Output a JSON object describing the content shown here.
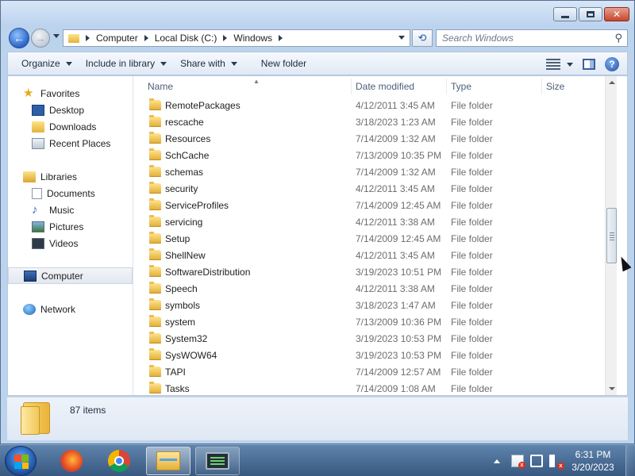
{
  "address": {
    "crumbs": [
      "Computer",
      "Local Disk (C:)",
      "Windows"
    ]
  },
  "search": {
    "placeholder": "Search Windows"
  },
  "toolbar": {
    "organize": "Organize",
    "include_in_library": "Include in library",
    "share_with": "Share with",
    "new_folder": "New folder"
  },
  "navpane": {
    "favorites": "Favorites",
    "desktop": "Desktop",
    "downloads": "Downloads",
    "recent_places": "Recent Places",
    "libraries": "Libraries",
    "documents": "Documents",
    "music": "Music",
    "pictures": "Pictures",
    "videos": "Videos",
    "computer": "Computer",
    "network": "Network"
  },
  "columns": {
    "name": "Name",
    "date_modified": "Date modified",
    "type": "Type",
    "size": "Size"
  },
  "rows": [
    {
      "name": "RemotePackages",
      "date": "4/12/2011 3:45 AM",
      "type": "File folder"
    },
    {
      "name": "rescache",
      "date": "3/18/2023 1:23 AM",
      "type": "File folder"
    },
    {
      "name": "Resources",
      "date": "7/14/2009 1:32 AM",
      "type": "File folder"
    },
    {
      "name": "SchCache",
      "date": "7/13/2009 10:35 PM",
      "type": "File folder"
    },
    {
      "name": "schemas",
      "date": "7/14/2009 1:32 AM",
      "type": "File folder"
    },
    {
      "name": "security",
      "date": "4/12/2011 3:45 AM",
      "type": "File folder"
    },
    {
      "name": "ServiceProfiles",
      "date": "7/14/2009 12:45 AM",
      "type": "File folder"
    },
    {
      "name": "servicing",
      "date": "4/12/2011 3:38 AM",
      "type": "File folder"
    },
    {
      "name": "Setup",
      "date": "7/14/2009 12:45 AM",
      "type": "File folder"
    },
    {
      "name": "ShellNew",
      "date": "4/12/2011 3:45 AM",
      "type": "File folder"
    },
    {
      "name": "SoftwareDistribution",
      "date": "3/19/2023 10:51 PM",
      "type": "File folder"
    },
    {
      "name": "Speech",
      "date": "4/12/2011 3:38 AM",
      "type": "File folder"
    },
    {
      "name": "symbols",
      "date": "3/18/2023 1:47 AM",
      "type": "File folder"
    },
    {
      "name": "system",
      "date": "7/13/2009 10:36 PM",
      "type": "File folder"
    },
    {
      "name": "System32",
      "date": "3/19/2023 10:53 PM",
      "type": "File folder"
    },
    {
      "name": "SysWOW64",
      "date": "3/19/2023 10:53 PM",
      "type": "File folder"
    },
    {
      "name": "TAPI",
      "date": "7/14/2009 12:57 AM",
      "type": "File folder"
    },
    {
      "name": "Tasks",
      "date": "7/14/2009 1:08 AM",
      "type": "File folder"
    }
  ],
  "status": {
    "items": "87 items"
  },
  "clock": {
    "time": "6:31 PM",
    "date": "3/20/2023"
  },
  "icons": {
    "back": "back-arrow-icon",
    "forward": "forward-arrow-icon",
    "refresh": "refresh-icon",
    "search": "search-icon",
    "help": "help-icon"
  }
}
